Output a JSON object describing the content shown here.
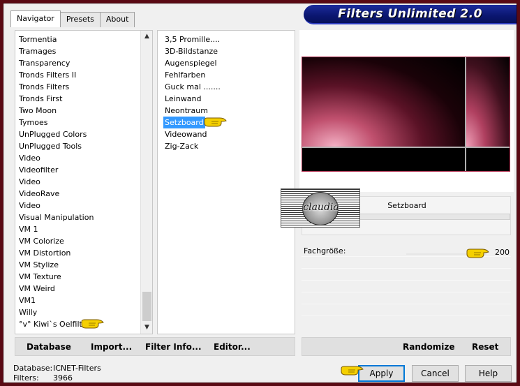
{
  "banner": {
    "title": "Filters Unlimited 2.0"
  },
  "tabs": [
    {
      "label": "Navigator"
    },
    {
      "label": "Presets"
    },
    {
      "label": "About"
    }
  ],
  "categories": [
    "Tormentia",
    "Tramages",
    "Transparency",
    "Tronds Filters II",
    "Tronds Filters",
    "Tronds First",
    "Two Moon",
    "Tymoes",
    "UnPlugged Colors",
    "UnPlugged Tools",
    "Video",
    "Videofilter",
    "Video",
    "VideoRave",
    "Video",
    "Visual Manipulation",
    "VM 1",
    "VM Colorize",
    "VM Distortion",
    "VM Stylize",
    "VM Texture",
    "VM Weird",
    "VM1",
    "Willy",
    "°v° Kiwi`s Oelfilter"
  ],
  "filters": [
    "3,5 Promille....",
    "3D-Bildstanze",
    "Augenspiegel",
    "Fehlfarben",
    "Guck mal .......",
    "Leinwand",
    "Neontraum",
    "Setzboard",
    "Videowand",
    "Zig-Zack"
  ],
  "selected_filter_index": 7,
  "selected_filter": "Setzboard",
  "watermark_text": "claudia",
  "params": [
    {
      "label": "Fachgröße:",
      "value": "200"
    }
  ],
  "bottom_left": {
    "database": "Database",
    "import": "Import...",
    "filter_info": "Filter Info...",
    "editor": "Editor..."
  },
  "bottom_right": {
    "randomize": "Randomize",
    "reset": "Reset"
  },
  "status": {
    "database_key": "Database:",
    "database_val": "ICNET-Filters",
    "filters_key": "Filters:",
    "filters_val": "3966"
  },
  "buttons": {
    "apply": "Apply",
    "cancel": "Cancel",
    "help": "Help"
  },
  "colors": {
    "selection": "#3399ff",
    "banner": "#0b1670",
    "frame": "#5a0a14"
  }
}
